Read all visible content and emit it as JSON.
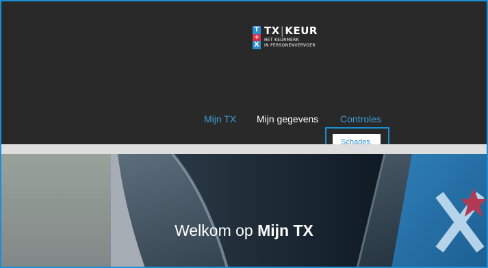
{
  "logo": {
    "mark_letters": [
      "T",
      "+",
      "X"
    ],
    "title_left": "TX",
    "title_right": "KEUR",
    "subtitle_line1": "HET KEURMERK",
    "subtitle_line2": "IN PERSONENVERVOER"
  },
  "nav": {
    "items": [
      {
        "label": "Mijn TX"
      },
      {
        "label": "Mijn gegevens"
      },
      {
        "label": "Controles"
      }
    ],
    "dropdown": {
      "label": "Schades"
    }
  },
  "hero": {
    "title_prefix": "Welkom op",
    "title_bold": "Mijn TX"
  },
  "colors": {
    "accent_blue": "#2b8fd0",
    "header_bg": "#292929",
    "logo_red": "#d9304a",
    "highlight_border": "#1a8fd6"
  }
}
